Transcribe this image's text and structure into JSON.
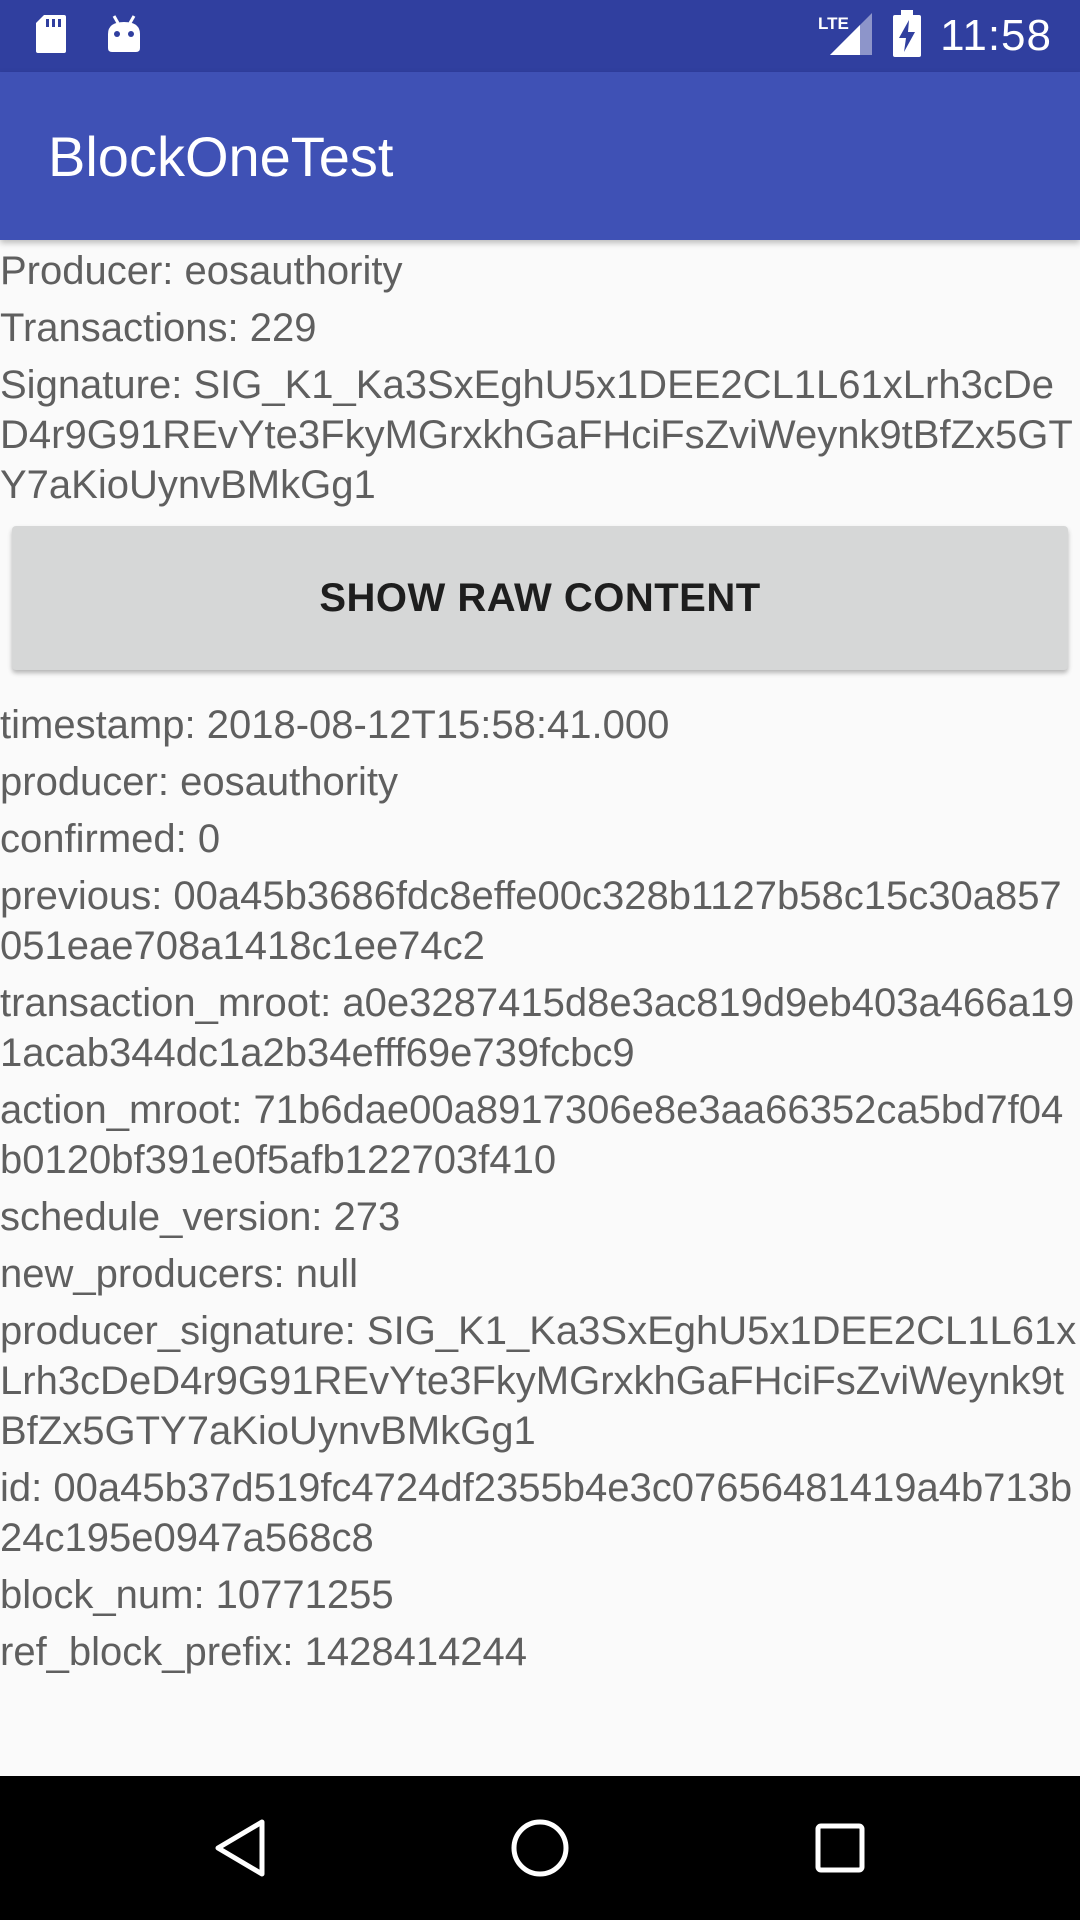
{
  "status_bar": {
    "time": "11:58",
    "network": "LTE",
    "left_icons": [
      "sd-card-icon",
      "android-debug-icon"
    ],
    "right_icons": [
      "lte-signal-icon",
      "battery-charging-icon"
    ],
    "background": "#303f9f"
  },
  "app_bar": {
    "title": "BlockOneTest",
    "background": "#3f51b5"
  },
  "summary": {
    "producer": "Producer: eosauthority",
    "transactions": "Transactions: 229",
    "signature": "Signature: SIG_K1_Ka3SxEghU5x1DEE2CL1L61xLrh3cDeD4r9G91REvYte3FkyMGrxkhGaFHciFsZviWeynk9tBfZx5GTY7aKioUynvBMkGg1"
  },
  "button": {
    "label": "SHOW RAW CONTENT"
  },
  "raw_content": [
    "timestamp: 2018-08-12T15:58:41.000",
    "producer: eosauthority",
    "confirmed: 0",
    "previous: 00a45b3686fdc8effe00c328b1127b58c15c30a857051eae708a1418c1ee74c2",
    "transaction_mroot: a0e3287415d8e3ac819d9eb403a466a191acab344dc1a2b34efff69e739fcbc9",
    "action_mroot: 71b6dae00a8917306e8e3aa66352ca5bd7f04b0120bf391e0f5afb122703f410",
    "schedule_version: 273",
    "new_producers: null",
    "producer_signature: SIG_K1_Ka3SxEghU5x1DEE2CL1L61xLrh3cDeD4r9G91REvYte3FkyMGrxkhGaFHciFsZviWeynk9tBfZx5GTY7aKioUynvBMkGg1",
    "id: 00a45b37d519fc4724df2355b4e3c07656481419a4b713b24c195e0947a568c8",
    "block_num: 10771255",
    "ref_block_prefix: 1428414244"
  ],
  "nav_bar": {
    "buttons": [
      "back-icon",
      "home-icon",
      "recents-icon"
    ]
  }
}
